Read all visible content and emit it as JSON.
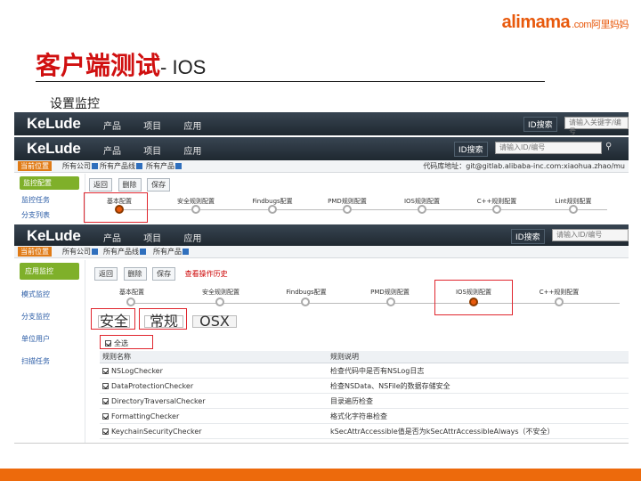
{
  "slide": {
    "logo": "alimama",
    "logo_suffix": ".com阿里妈妈",
    "title": "客户端测试",
    "title_suffix": "- IOS",
    "subtitle": "设置监控"
  },
  "app": {
    "brand": "KeLude",
    "nav": [
      "产品",
      "项目",
      "应用"
    ],
    "search_type": "ID搜索",
    "search_placeholder": "请输入关键字/编号",
    "search_placeholder_alt": "请输入ID/编号"
  },
  "shot2": {
    "location_label": "当前位置",
    "crumbs": [
      "所有公司",
      "所有产品线",
      "所有产品"
    ],
    "address": "代码库地址：git@gitlab.alibaba-inc.com:xiaohua.zhao/mu",
    "side": [
      "监控配置",
      "监控任务",
      "分支列表"
    ],
    "tools": [
      "返回",
      "删除",
      "保存"
    ],
    "steps": [
      "基本配置",
      "安全规则配置",
      "Findbugs配置",
      "PMD规则配置",
      "IOS规则配置",
      "C++规则配置",
      "Lint规则配置"
    ]
  },
  "shot3": {
    "location_label": "当前位置",
    "crumbs": [
      "所有公司",
      "所有产品线",
      "所有产品"
    ],
    "side": [
      "应用监控",
      "模式监控",
      "分支监控",
      "单位用户",
      "扫描任务"
    ],
    "tools": [
      "返回",
      "删除",
      "保存"
    ],
    "tools_link": "查看操作历史",
    "steps": [
      "基本配置",
      "安全规则配置",
      "Findbugs配置",
      "PMD规则配置",
      "IOS规则配置",
      "C++规则配置"
    ],
    "tabs": [
      "安全",
      "常规",
      "OSX"
    ],
    "select_all": "全选",
    "table_headers": [
      "规则名称",
      "规则说明"
    ],
    "rows": [
      {
        "name": "NSLogChecker",
        "desc": "检查代码中是否有NSLog日志"
      },
      {
        "name": "DataProtectionChecker",
        "desc": "检查NSData、NSFile的数据存储安全"
      },
      {
        "name": "DirectoryTraversalChecker",
        "desc": "目录遍历检查"
      },
      {
        "name": "FormattingChecker",
        "desc": "格式化字符串检查"
      },
      {
        "name": "KeychainSecurityChecker",
        "desc": "kSecAttrAccessible值是否为kSecAttrAccessibleAlways（不安全）"
      }
    ]
  },
  "colors": {
    "accent": "#e8590c",
    "title_red": "#d01010",
    "highlight": "#e0262e",
    "topbar": "#2a333c",
    "side_active": "#7fb02a"
  }
}
